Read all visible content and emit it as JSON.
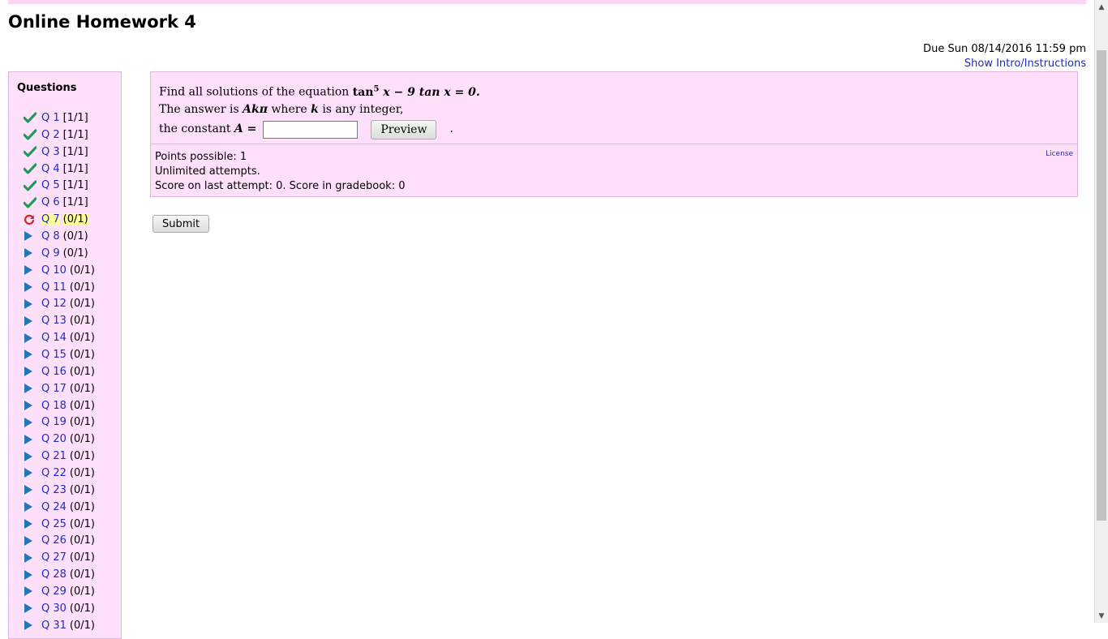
{
  "page": {
    "title": "Online Homework 4",
    "due": "Due Sun 08/14/2016 11:59 pm",
    "intro_link": "Show Intro/Instructions"
  },
  "sidebar": {
    "title": "Questions",
    "items": [
      {
        "label": "Q 1",
        "score": "[1/1]",
        "status": "correct"
      },
      {
        "label": "Q 2",
        "score": "[1/1]",
        "status": "correct"
      },
      {
        "label": "Q 3",
        "score": "[1/1]",
        "status": "correct"
      },
      {
        "label": "Q 4",
        "score": "[1/1]",
        "status": "correct"
      },
      {
        "label": "Q 5",
        "score": "[1/1]",
        "status": "correct"
      },
      {
        "label": "Q 6",
        "score": "[1/1]",
        "status": "correct"
      },
      {
        "label": "Q 7",
        "score": "(0/1)",
        "status": "current"
      },
      {
        "label": "Q 8",
        "score": "(0/1)",
        "status": "todo"
      },
      {
        "label": "Q 9",
        "score": "(0/1)",
        "status": "todo"
      },
      {
        "label": "Q 10",
        "score": "(0/1)",
        "status": "todo"
      },
      {
        "label": "Q 11",
        "score": "(0/1)",
        "status": "todo"
      },
      {
        "label": "Q 12",
        "score": "(0/1)",
        "status": "todo"
      },
      {
        "label": "Q 13",
        "score": "(0/1)",
        "status": "todo"
      },
      {
        "label": "Q 14",
        "score": "(0/1)",
        "status": "todo"
      },
      {
        "label": "Q 15",
        "score": "(0/1)",
        "status": "todo"
      },
      {
        "label": "Q 16",
        "score": "(0/1)",
        "status": "todo"
      },
      {
        "label": "Q 17",
        "score": "(0/1)",
        "status": "todo"
      },
      {
        "label": "Q 18",
        "score": "(0/1)",
        "status": "todo"
      },
      {
        "label": "Q 19",
        "score": "(0/1)",
        "status": "todo"
      },
      {
        "label": "Q 20",
        "score": "(0/1)",
        "status": "todo"
      },
      {
        "label": "Q 21",
        "score": "(0/1)",
        "status": "todo"
      },
      {
        "label": "Q 22",
        "score": "(0/1)",
        "status": "todo"
      },
      {
        "label": "Q 23",
        "score": "(0/1)",
        "status": "todo"
      },
      {
        "label": "Q 24",
        "score": "(0/1)",
        "status": "todo"
      },
      {
        "label": "Q 25",
        "score": "(0/1)",
        "status": "todo"
      },
      {
        "label": "Q 26",
        "score": "(0/1)",
        "status": "todo"
      },
      {
        "label": "Q 27",
        "score": "(0/1)",
        "status": "todo"
      },
      {
        "label": "Q 28",
        "score": "(0/1)",
        "status": "todo"
      },
      {
        "label": "Q 29",
        "score": "(0/1)",
        "status": "todo"
      },
      {
        "label": "Q 30",
        "score": "(0/1)",
        "status": "todo"
      },
      {
        "label": "Q 31",
        "score": "(0/1)",
        "status": "todo"
      }
    ]
  },
  "question": {
    "line1_prefix": "Find all solutions of the equation",
    "eq_tan": "tan",
    "eq_exp": "5",
    "eq_rest": "x − 9 tan x = 0.",
    "line2_prefix": "The answer is",
    "line2_math": "Akπ",
    "line2_middle": "where",
    "line2_k": "k",
    "line2_suffix": "is any integer,",
    "line3_prefix": "the constant",
    "line3_math": "A =",
    "answer_value": "",
    "preview_label": "Preview",
    "trailing": ".",
    "license_label": "License",
    "points": "Points possible: 1",
    "attempts": "Unlimited attempts.",
    "score_line": "Score on last attempt: 0. Score in gradebook: 0"
  },
  "submit_label": "Submit",
  "icons": {
    "correct": "check-icon",
    "current": "retry-icon",
    "todo": "play-arrow-icon"
  },
  "colors": {
    "panel_bg": "#ffe0fb",
    "link": "#1a2bc8",
    "check": "#22995a",
    "retry": "#d32121",
    "arrow": "#2477b6",
    "current_highlight": "#ffff99"
  }
}
